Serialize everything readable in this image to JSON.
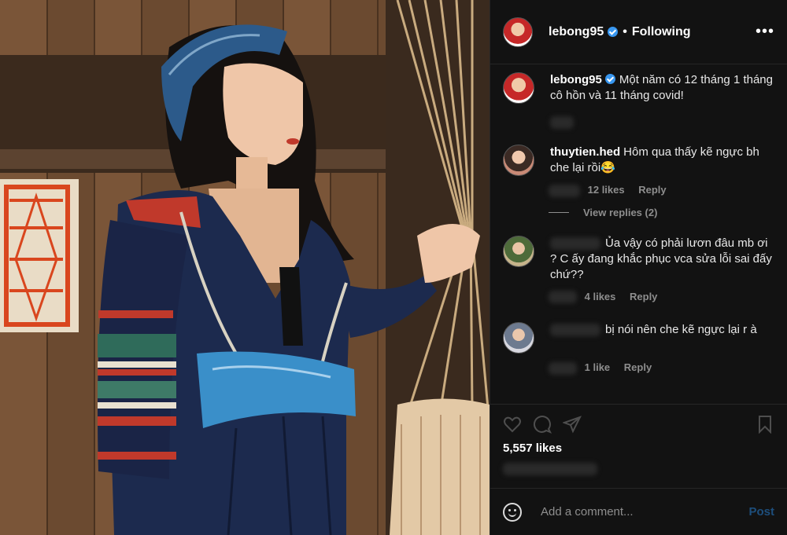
{
  "post": {
    "author": "lebong95",
    "follow_status": "Following",
    "separator": "•",
    "more_menu": "•••",
    "caption": "Một năm có 12 tháng 1 tháng cô hồn và 11 tháng covid!"
  },
  "comments": [
    {
      "username": "thuytien.hed",
      "text": "Hôm qua thấy kẽ ngực bh che lại rồi😂",
      "likes": "12 likes",
      "reply": "Reply",
      "view_replies": "View replies (2)"
    },
    {
      "username": "",
      "text": "Ủa vậy có phải lươn đâu mb ơi ? C ấy đang khắc phục vca sửa lỗi sai đấy chứ??",
      "likes": "4 likes",
      "reply": "Reply"
    },
    {
      "username": "",
      "text": "bị nói nên che kẽ ngực lại r à",
      "likes": "1 like",
      "reply": "Reply"
    }
  ],
  "engagement": {
    "likes_count": "5,557 likes"
  },
  "add_comment": {
    "placeholder": "Add a comment...",
    "post_label": "Post"
  },
  "icons": [
    "heart-icon",
    "comment-icon",
    "share-icon",
    "bookmark-icon",
    "emoji-icon",
    "more-icon",
    "verified-badge-icon"
  ]
}
